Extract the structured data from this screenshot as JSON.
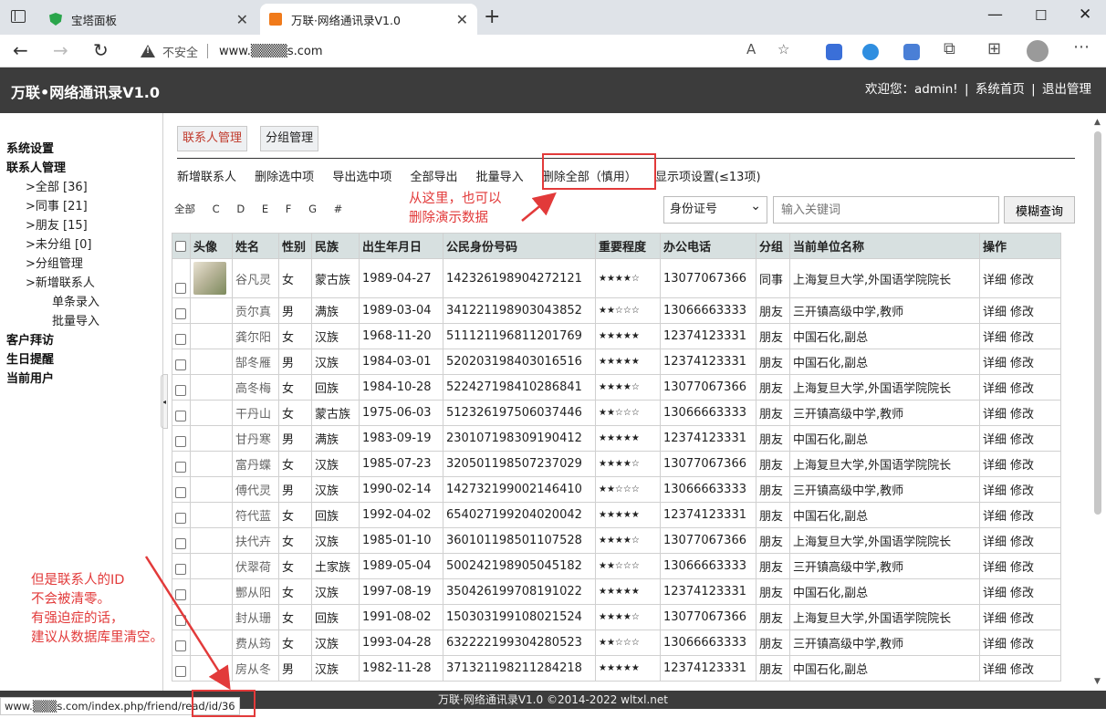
{
  "browser": {
    "tabs": [
      {
        "title": "宝塔面板",
        "icon": "shield-icon",
        "active": false
      },
      {
        "title": "万联·网络通讯录V1.0",
        "icon": "book-icon",
        "active": true
      }
    ],
    "insecure_label": "不安全",
    "url": "www.▒▒▒▒s.com"
  },
  "app": {
    "title": "万联•网络通讯录V1.0",
    "welcome": "欢迎您：admin!",
    "sep": "|",
    "links": [
      "系统首页",
      "退出管理"
    ]
  },
  "sidebar": {
    "items": [
      {
        "label": "系统设置",
        "level": 0
      },
      {
        "label": "联系人管理",
        "level": 0
      },
      {
        "label": ">全部 [36]",
        "level": 1
      },
      {
        "label": ">同事 [21]",
        "level": 1
      },
      {
        "label": ">朋友 [15]",
        "level": 1
      },
      {
        "label": ">未分组 [0]",
        "level": 1
      },
      {
        "label": ">分组管理",
        "level": 1
      },
      {
        "label": ">新增联系人",
        "level": 1
      },
      {
        "label": "单条录入",
        "level": 2
      },
      {
        "label": "批量导入",
        "level": 2
      },
      {
        "label": "客户拜访",
        "level": 0
      },
      {
        "label": "生日提醒",
        "level": 0
      },
      {
        "label": "当前用户",
        "level": 0
      }
    ]
  },
  "main": {
    "tabs": [
      "联系人管理",
      "分组管理"
    ],
    "actions": [
      "新增联系人",
      "删除选中项",
      "导出选中项",
      "全部导出",
      "批量导入",
      "删除全部（慎用）",
      "显示项设置(≤13项)"
    ],
    "letters": [
      "全部",
      "C",
      "D",
      "E",
      "F",
      "G",
      "#"
    ],
    "search": {
      "field_selected": "身份证号",
      "placeholder": "输入关键词",
      "button": "模糊查询"
    }
  },
  "table": {
    "headers": [
      "头像",
      "姓名",
      "性别",
      "民族",
      "出生年月日",
      "公民身份号码",
      "重要程度",
      "办公电话",
      "分组",
      "当前单位名称",
      "操作"
    ],
    "ops": [
      "详细",
      "修改"
    ],
    "rows": [
      {
        "name": "谷凡灵",
        "sex": "女",
        "ethnic": "蒙古族",
        "birth": "1989-04-27",
        "id": "142326198904272121",
        "stars": "★★★★☆",
        "phone": "13077067366",
        "group": "同事",
        "org": "上海复旦大学,外国语学院院长",
        "avatar": true
      },
      {
        "name": "贡尔真",
        "sex": "男",
        "ethnic": "满族",
        "birth": "1989-03-04",
        "id": "341221198903043852",
        "stars": "★★☆☆☆",
        "phone": "13066663333",
        "group": "朋友",
        "org": "三开镇高级中学,教师"
      },
      {
        "name": "龚尔阳",
        "sex": "女",
        "ethnic": "汉族",
        "birth": "1968-11-20",
        "id": "511121196811201769",
        "stars": "★★★★★",
        "phone": "12374123331",
        "group": "朋友",
        "org": "中国石化,副总"
      },
      {
        "name": "郜冬雁",
        "sex": "男",
        "ethnic": "汉族",
        "birth": "1984-03-01",
        "id": "520203198403016516",
        "stars": "★★★★★",
        "phone": "12374123331",
        "group": "朋友",
        "org": "中国石化,副总"
      },
      {
        "name": "高冬梅",
        "sex": "女",
        "ethnic": "回族",
        "birth": "1984-10-28",
        "id": "522427198410286841",
        "stars": "★★★★☆",
        "phone": "13077067366",
        "group": "朋友",
        "org": "上海复旦大学,外国语学院院长"
      },
      {
        "name": "干丹山",
        "sex": "女",
        "ethnic": "蒙古族",
        "birth": "1975-06-03",
        "id": "512326197506037446",
        "stars": "★★☆☆☆",
        "phone": "13066663333",
        "group": "朋友",
        "org": "三开镇高级中学,教师"
      },
      {
        "name": "甘丹寒",
        "sex": "男",
        "ethnic": "满族",
        "birth": "1983-09-19",
        "id": "230107198309190412",
        "stars": "★★★★★",
        "phone": "12374123331",
        "group": "朋友",
        "org": "中国石化,副总"
      },
      {
        "name": "富丹蝶",
        "sex": "女",
        "ethnic": "汉族",
        "birth": "1985-07-23",
        "id": "320501198507237029",
        "stars": "★★★★☆",
        "phone": "13077067366",
        "group": "朋友",
        "org": "上海复旦大学,外国语学院院长"
      },
      {
        "name": "傅代灵",
        "sex": "男",
        "ethnic": "汉族",
        "birth": "1990-02-14",
        "id": "142732199002146410",
        "stars": "★★☆☆☆",
        "phone": "13066663333",
        "group": "朋友",
        "org": "三开镇高级中学,教师"
      },
      {
        "name": "符代蓝",
        "sex": "女",
        "ethnic": "回族",
        "birth": "1992-04-02",
        "id": "654027199204020042",
        "stars": "★★★★★",
        "phone": "12374123331",
        "group": "朋友",
        "org": "中国石化,副总"
      },
      {
        "name": "扶代卉",
        "sex": "女",
        "ethnic": "汉族",
        "birth": "1985-01-10",
        "id": "360101198501107528",
        "stars": "★★★★☆",
        "phone": "13077067366",
        "group": "朋友",
        "org": "上海复旦大学,外国语学院院长"
      },
      {
        "name": "伏翠荷",
        "sex": "女",
        "ethnic": "土家族",
        "birth": "1989-05-04",
        "id": "500242198905045182",
        "stars": "★★☆☆☆",
        "phone": "13066663333",
        "group": "朋友",
        "org": "三开镇高级中学,教师"
      },
      {
        "name": "酆从阳",
        "sex": "女",
        "ethnic": "汉族",
        "birth": "1997-08-19",
        "id": "350426199708191022",
        "stars": "★★★★★",
        "phone": "12374123331",
        "group": "朋友",
        "org": "中国石化,副总"
      },
      {
        "name": "封从珊",
        "sex": "女",
        "ethnic": "回族",
        "birth": "1991-08-02",
        "id": "150303199108021524",
        "stars": "★★★★☆",
        "phone": "13077067366",
        "group": "朋友",
        "org": "上海复旦大学,外国语学院院长"
      },
      {
        "name": "费从筠",
        "sex": "女",
        "ethnic": "汉族",
        "birth": "1993-04-28",
        "id": "632222199304280523",
        "stars": "★★☆☆☆",
        "phone": "13066663333",
        "group": "朋友",
        "org": "三开镇高级中学,教师"
      },
      {
        "name": "房从冬",
        "sex": "男",
        "ethnic": "汉族",
        "birth": "1982-11-28",
        "id": "371321198211284218",
        "stars": "★★★★★",
        "phone": "12374123331",
        "group": "朋友",
        "org": "中国石化,副总"
      }
    ]
  },
  "footer": "万联·网络通讯录V1.0 ©2014-2022 wltxl.net",
  "statusbar": "www.▒▒▒s.com/index.php/friend/read/id/36",
  "annotations": {
    "note1": [
      "从这里，也可以",
      "删除演示数据"
    ],
    "note2": [
      "但是联系人的ID",
      "不会被清零。",
      "有强迫症的话，",
      "建议从数据库里清空。"
    ],
    "color": "#e23a3a"
  }
}
